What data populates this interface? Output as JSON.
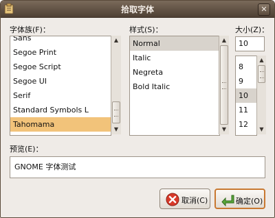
{
  "window": {
    "title": "拾取字体"
  },
  "family": {
    "label": "字体族(F)：",
    "items": [
      "Sans",
      "Segoe Print",
      "Segoe Script",
      "Segoe UI",
      "Serif",
      "Standard Symbols L",
      "Tahomama"
    ],
    "selected": "Tahomama"
  },
  "style": {
    "label": "样式(S)：",
    "items": [
      "Normal",
      "Italic",
      "Negreta",
      "Bold Italic"
    ],
    "selected": "Normal"
  },
  "size": {
    "label": "大小(Z)：",
    "value": "10",
    "items": [
      "8",
      "9",
      "10",
      "11",
      "12"
    ],
    "selected": "10"
  },
  "preview": {
    "label": "预览(E)：",
    "text": "GNOME 字体测试"
  },
  "buttons": {
    "cancel": "取消(C)",
    "ok": "确定(O)"
  },
  "colors": {
    "selection": "#f2c37a",
    "titlebar": "#5a4a3c",
    "default_border": "#c87830"
  }
}
